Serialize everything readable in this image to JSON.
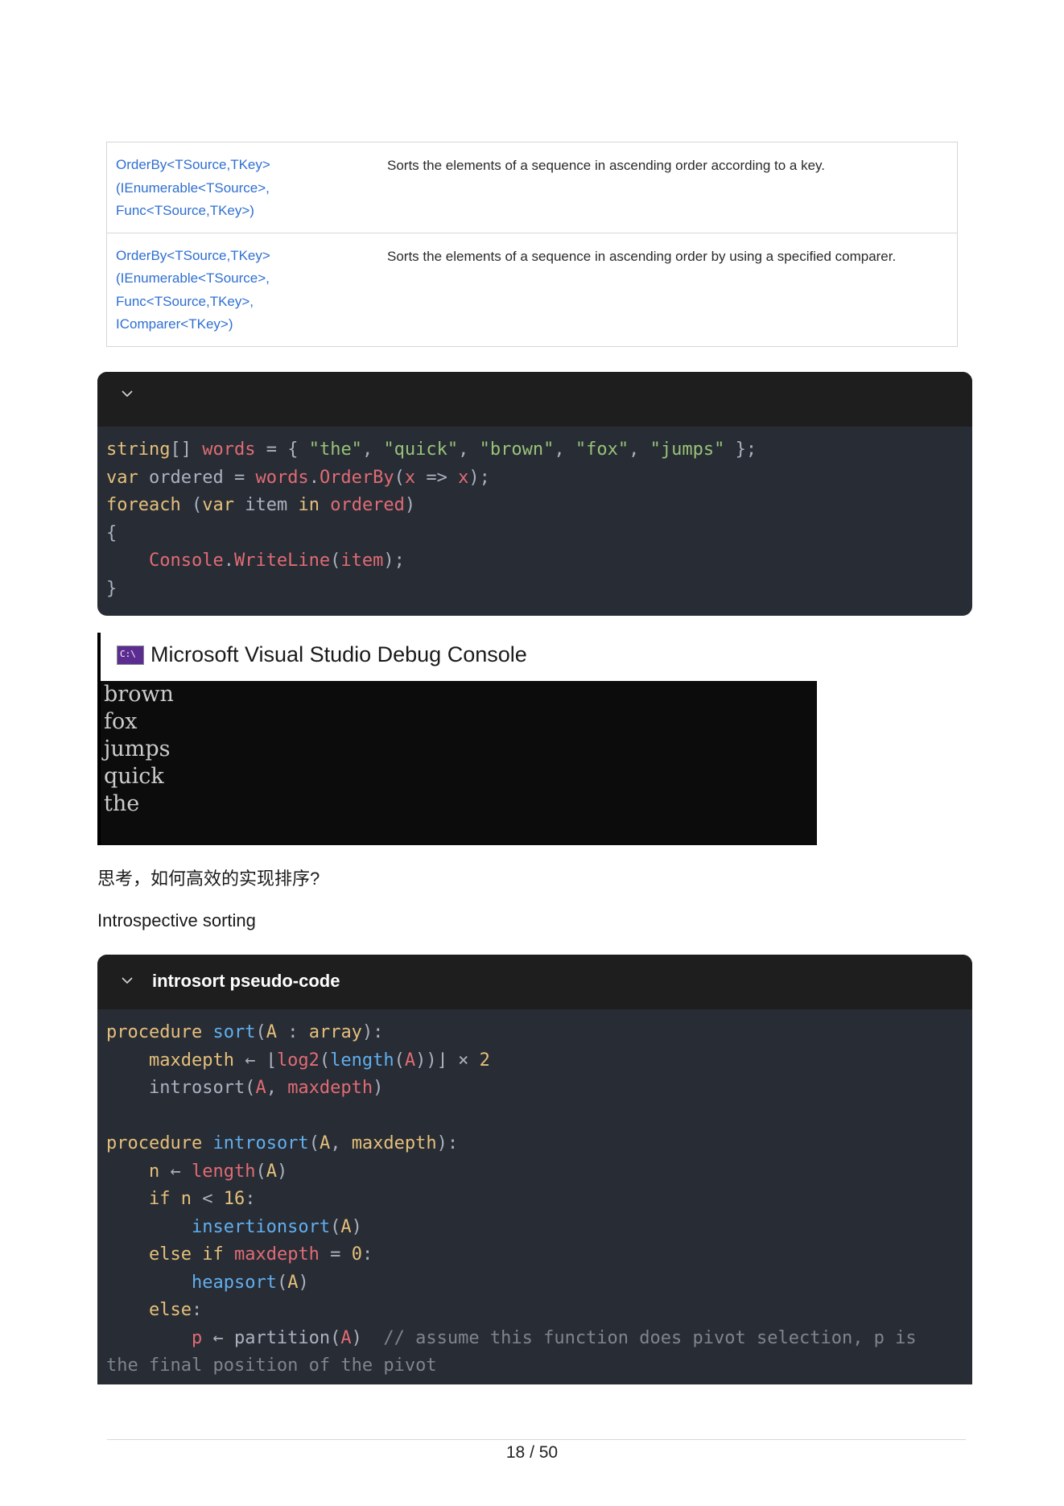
{
  "api_table": {
    "rows": [
      {
        "signature": [
          "OrderBy<TSource,TKey>",
          "(IEnumerable<TSource>,",
          "Func<TSource,TKey>)"
        ],
        "description": "Sorts the elements of a sequence in ascending order according to a key."
      },
      {
        "signature": [
          "OrderBy<TSource,TKey>",
          "(IEnumerable<TSource>,",
          "Func<TSource,TKey>,",
          "IComparer<TKey>)"
        ],
        "description": "Sorts the elements of a sequence in ascending order by using a specified comparer."
      }
    ]
  },
  "code_block_1": {
    "title": "",
    "lines": [
      [
        {
          "t": "string",
          "c": "kw"
        },
        {
          "t": "[] ",
          "c": "gray"
        },
        {
          "t": "words",
          "c": "red"
        },
        {
          "t": " = { ",
          "c": "gray"
        },
        {
          "t": "\"the\"",
          "c": "str"
        },
        {
          "t": ", ",
          "c": "gray"
        },
        {
          "t": "\"quick\"",
          "c": "str"
        },
        {
          "t": ", ",
          "c": "gray"
        },
        {
          "t": "\"brown\"",
          "c": "str"
        },
        {
          "t": ", ",
          "c": "gray"
        },
        {
          "t": "\"fox\"",
          "c": "str"
        },
        {
          "t": ", ",
          "c": "gray"
        },
        {
          "t": "\"jumps\"",
          "c": "str"
        },
        {
          "t": " };",
          "c": "gray"
        }
      ],
      [
        {
          "t": "var",
          "c": "kw"
        },
        {
          "t": " ordered = ",
          "c": "gray"
        },
        {
          "t": "words",
          "c": "red"
        },
        {
          "t": ".",
          "c": "gray"
        },
        {
          "t": "OrderBy",
          "c": "red"
        },
        {
          "t": "(",
          "c": "gray"
        },
        {
          "t": "x",
          "c": "red"
        },
        {
          "t": " => ",
          "c": "gray"
        },
        {
          "t": "x",
          "c": "red"
        },
        {
          "t": ");",
          "c": "gray"
        }
      ],
      [
        {
          "t": "foreach",
          "c": "kw"
        },
        {
          "t": " (",
          "c": "gray"
        },
        {
          "t": "var",
          "c": "kw"
        },
        {
          "t": " item ",
          "c": "gray"
        },
        {
          "t": "in",
          "c": "kw"
        },
        {
          "t": " ",
          "c": "gray"
        },
        {
          "t": "ordered",
          "c": "red"
        },
        {
          "t": ")",
          "c": "gray"
        }
      ],
      [
        {
          "t": "{",
          "c": "gray"
        }
      ],
      [
        {
          "t": "    ",
          "c": "gray"
        },
        {
          "t": "Console",
          "c": "red"
        },
        {
          "t": ".",
          "c": "gray"
        },
        {
          "t": "WriteLine",
          "c": "red"
        },
        {
          "t": "(",
          "c": "gray"
        },
        {
          "t": "item",
          "c": "red"
        },
        {
          "t": ");",
          "c": "gray"
        }
      ],
      [
        {
          "t": "}",
          "c": "gray"
        }
      ]
    ]
  },
  "debug_console": {
    "title": "Microsoft Visual Studio Debug Console",
    "icon_text": "C:\\",
    "output": [
      "brown",
      "fox",
      "jumps",
      "quick",
      "the"
    ]
  },
  "paragraphs": {
    "question": "思考，如何高效的实现排序?",
    "heading": "Introspective sorting"
  },
  "code_block_2": {
    "title": "introsort pseudo-code",
    "lines": [
      [
        {
          "t": "procedure",
          "c": "kw"
        },
        {
          "t": " ",
          "c": "gray"
        },
        {
          "t": "sort",
          "c": "blue"
        },
        {
          "t": "(",
          "c": "gray"
        },
        {
          "t": "A",
          "c": "kw"
        },
        {
          "t": " : ",
          "c": "gray"
        },
        {
          "t": "array",
          "c": "kw"
        },
        {
          "t": "):",
          "c": "gray"
        }
      ],
      [
        {
          "t": "    ",
          "c": "gray"
        },
        {
          "t": "maxdepth",
          "c": "kw"
        },
        {
          "t": " ← ⌊",
          "c": "gray"
        },
        {
          "t": "log2",
          "c": "red"
        },
        {
          "t": "(",
          "c": "gray"
        },
        {
          "t": "length",
          "c": "blue"
        },
        {
          "t": "(",
          "c": "gray"
        },
        {
          "t": "A",
          "c": "red"
        },
        {
          "t": "))⌋ × ",
          "c": "gray"
        },
        {
          "t": "2",
          "c": "kw"
        }
      ],
      [
        {
          "t": "    introsort(",
          "c": "gray"
        },
        {
          "t": "A",
          "c": "red"
        },
        {
          "t": ", ",
          "c": "gray"
        },
        {
          "t": "maxdepth",
          "c": "red"
        },
        {
          "t": ")",
          "c": "gray"
        }
      ],
      [],
      [
        {
          "t": "procedure",
          "c": "kw"
        },
        {
          "t": " ",
          "c": "gray"
        },
        {
          "t": "introsort",
          "c": "blue"
        },
        {
          "t": "(",
          "c": "gray"
        },
        {
          "t": "A",
          "c": "kw"
        },
        {
          "t": ", ",
          "c": "gray"
        },
        {
          "t": "maxdepth",
          "c": "kw"
        },
        {
          "t": "):",
          "c": "gray"
        }
      ],
      [
        {
          "t": "    ",
          "c": "gray"
        },
        {
          "t": "n",
          "c": "kw"
        },
        {
          "t": " ← ",
          "c": "gray"
        },
        {
          "t": "length",
          "c": "red"
        },
        {
          "t": "(",
          "c": "gray"
        },
        {
          "t": "A",
          "c": "kw"
        },
        {
          "t": ")",
          "c": "gray"
        }
      ],
      [
        {
          "t": "    ",
          "c": "gray"
        },
        {
          "t": "if",
          "c": "kw"
        },
        {
          "t": " ",
          "c": "gray"
        },
        {
          "t": "n",
          "c": "kw"
        },
        {
          "t": " < ",
          "c": "gray"
        },
        {
          "t": "16",
          "c": "kw"
        },
        {
          "t": ":",
          "c": "gray"
        }
      ],
      [
        {
          "t": "        ",
          "c": "gray"
        },
        {
          "t": "insertionsort",
          "c": "blue"
        },
        {
          "t": "(",
          "c": "gray"
        },
        {
          "t": "A",
          "c": "kw"
        },
        {
          "t": ")",
          "c": "gray"
        }
      ],
      [
        {
          "t": "    ",
          "c": "gray"
        },
        {
          "t": "else",
          "c": "kw"
        },
        {
          "t": " ",
          "c": "gray"
        },
        {
          "t": "if",
          "c": "kw"
        },
        {
          "t": " ",
          "c": "gray"
        },
        {
          "t": "maxdepth",
          "c": "red"
        },
        {
          "t": " = ",
          "c": "gray"
        },
        {
          "t": "0",
          "c": "kw"
        },
        {
          "t": ":",
          "c": "gray"
        }
      ],
      [
        {
          "t": "        ",
          "c": "gray"
        },
        {
          "t": "heapsort",
          "c": "blue"
        },
        {
          "t": "(",
          "c": "gray"
        },
        {
          "t": "A",
          "c": "kw"
        },
        {
          "t": ")",
          "c": "gray"
        }
      ],
      [
        {
          "t": "    ",
          "c": "gray"
        },
        {
          "t": "else",
          "c": "kw"
        },
        {
          "t": ":",
          "c": "gray"
        }
      ],
      [
        {
          "t": "        ",
          "c": "gray"
        },
        {
          "t": "p",
          "c": "red"
        },
        {
          "t": " ← partition(",
          "c": "gray"
        },
        {
          "t": "A",
          "c": "red"
        },
        {
          "t": ")  ",
          "c": "gray"
        },
        {
          "t": "// assume this function does pivot selection, p is",
          "c": "cmt"
        }
      ],
      [
        {
          "t": "the final position of the pivot",
          "c": "cmt"
        }
      ]
    ]
  },
  "footer": {
    "page": "18 / 50"
  }
}
